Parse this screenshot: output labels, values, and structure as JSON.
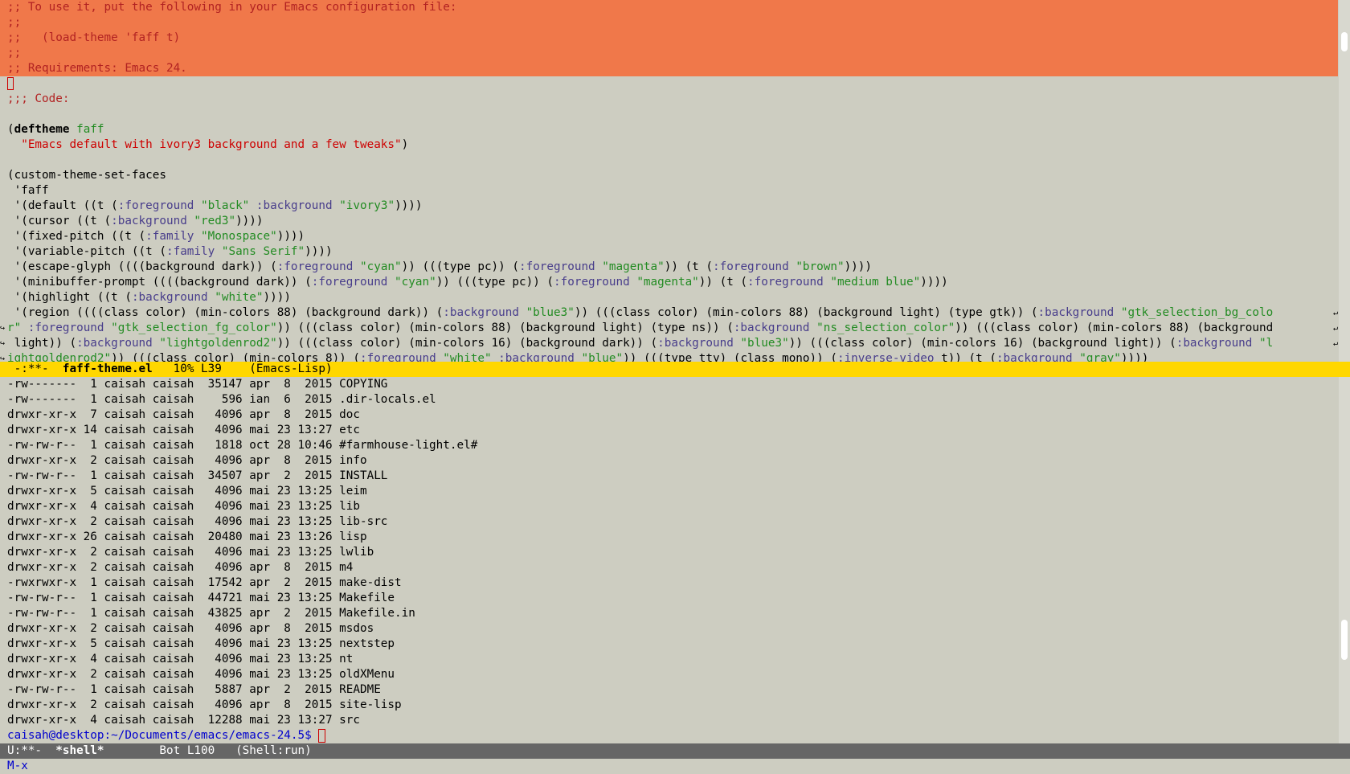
{
  "top_buffer": {
    "region_lines": [
      ";; To use it, put the following in your Emacs configuration file:",
      ";;",
      ";;   (load-theme 'faff t)",
      ";;",
      ";; Requirements: Emacs 24."
    ],
    "code_comment": ";;; Code:",
    "deftheme_kw": "deftheme",
    "deftheme_name": "faff",
    "deftheme_doc": "\"Emacs default with ivory3 background and a few tweaks\"",
    "custom_fn": "(custom-theme-set-faces",
    "quote_faff": " 'faff",
    "face_lines": [
      [
        {
          "t": " '(default ((t (",
          "c": ""
        },
        {
          "t": ":foreground",
          "c": "b"
        },
        {
          "t": " ",
          "c": ""
        },
        {
          "t": "\"black\"",
          "c": "s"
        },
        {
          "t": " ",
          "c": ""
        },
        {
          "t": ":background",
          "c": "b"
        },
        {
          "t": " ",
          "c": ""
        },
        {
          "t": "\"ivory3\"",
          "c": "s"
        },
        {
          "t": "))))",
          "c": ""
        }
      ],
      [
        {
          "t": " '(cursor ((t (",
          "c": ""
        },
        {
          "t": ":background",
          "c": "b"
        },
        {
          "t": " ",
          "c": ""
        },
        {
          "t": "\"red3\"",
          "c": "s"
        },
        {
          "t": "))))",
          "c": ""
        }
      ],
      [
        {
          "t": " '(fixed-pitch ((t (",
          "c": ""
        },
        {
          "t": ":family",
          "c": "b"
        },
        {
          "t": " ",
          "c": ""
        },
        {
          "t": "\"Monospace\"",
          "c": "s"
        },
        {
          "t": "))))",
          "c": ""
        }
      ],
      [
        {
          "t": " '(variable-pitch ((t (",
          "c": ""
        },
        {
          "t": ":family",
          "c": "b"
        },
        {
          "t": " ",
          "c": ""
        },
        {
          "t": "\"Sans Serif\"",
          "c": "s"
        },
        {
          "t": "))))",
          "c": ""
        }
      ],
      [
        {
          "t": " '(escape-glyph ((((background dark)) (",
          "c": ""
        },
        {
          "t": ":foreground",
          "c": "b"
        },
        {
          "t": " ",
          "c": ""
        },
        {
          "t": "\"cyan\"",
          "c": "s"
        },
        {
          "t": ")) (((type pc)) (",
          "c": ""
        },
        {
          "t": ":foreground",
          "c": "b"
        },
        {
          "t": " ",
          "c": ""
        },
        {
          "t": "\"magenta\"",
          "c": "s"
        },
        {
          "t": ")) (t (",
          "c": ""
        },
        {
          "t": ":foreground",
          "c": "b"
        },
        {
          "t": " ",
          "c": ""
        },
        {
          "t": "\"brown\"",
          "c": "s"
        },
        {
          "t": "))))",
          "c": ""
        }
      ],
      [
        {
          "t": " '(minibuffer-prompt ((((background dark)) (",
          "c": ""
        },
        {
          "t": ":foreground",
          "c": "b"
        },
        {
          "t": " ",
          "c": ""
        },
        {
          "t": "\"cyan\"",
          "c": "s"
        },
        {
          "t": ")) (((type pc)) (",
          "c": ""
        },
        {
          "t": ":foreground",
          "c": "b"
        },
        {
          "t": " ",
          "c": ""
        },
        {
          "t": "\"magenta\"",
          "c": "s"
        },
        {
          "t": ")) (t (",
          "c": ""
        },
        {
          "t": ":foreground",
          "c": "b"
        },
        {
          "t": " ",
          "c": ""
        },
        {
          "t": "\"medium blue\"",
          "c": "s"
        },
        {
          "t": "))))",
          "c": ""
        }
      ],
      [
        {
          "t": " '(highlight ((t (",
          "c": ""
        },
        {
          "t": ":background",
          "c": "b"
        },
        {
          "t": " ",
          "c": ""
        },
        {
          "t": "\"white\"",
          "c": "s"
        },
        {
          "t": "))))",
          "c": ""
        }
      ],
      [
        {
          "t": " '(region ((((class color) (min-colors 88) (background dark)) (",
          "c": ""
        },
        {
          "t": ":background",
          "c": "b"
        },
        {
          "t": " ",
          "c": ""
        },
        {
          "t": "\"blue3\"",
          "c": "s"
        },
        {
          "t": ")) (((class color) (min-colors 88) (background light) (type gtk)) (",
          "c": ""
        },
        {
          "t": ":background",
          "c": "b"
        },
        {
          "t": " ",
          "c": ""
        },
        {
          "t": "\"gtk_selection_bg_colo",
          "c": "s"
        }
      ],
      [
        {
          "t": "r\"",
          "c": "s"
        },
        {
          "t": " ",
          "c": ""
        },
        {
          "t": ":foreground",
          "c": "b"
        },
        {
          "t": " ",
          "c": ""
        },
        {
          "t": "\"gtk_selection_fg_color\"",
          "c": "s"
        },
        {
          "t": ")) (((class color) (min-colors 88) (background light) (type ns)) (",
          "c": ""
        },
        {
          "t": ":background",
          "c": "b"
        },
        {
          "t": " ",
          "c": ""
        },
        {
          "t": "\"ns_selection_color\"",
          "c": "s"
        },
        {
          "t": ")) (((class color) (min-colors 88) (background",
          "c": ""
        }
      ],
      [
        {
          "t": " light)) (",
          "c": ""
        },
        {
          "t": ":background",
          "c": "b"
        },
        {
          "t": " ",
          "c": ""
        },
        {
          "t": "\"lightgoldenrod2\"",
          "c": "s"
        },
        {
          "t": ")) (((class color) (min-colors 16) (background dark)) (",
          "c": ""
        },
        {
          "t": ":background",
          "c": "b"
        },
        {
          "t": " ",
          "c": ""
        },
        {
          "t": "\"blue3\"",
          "c": "s"
        },
        {
          "t": ")) (((class color) (min-colors 16) (background light)) (",
          "c": ""
        },
        {
          "t": ":background",
          "c": "b"
        },
        {
          "t": " ",
          "c": ""
        },
        {
          "t": "\"l",
          "c": "s"
        }
      ],
      [
        {
          "t": "ightgoldenrod2\"",
          "c": "s"
        },
        {
          "t": ")) (((class color) (min-colors 8)) (",
          "c": ""
        },
        {
          "t": ":foreground",
          "c": "b"
        },
        {
          "t": " ",
          "c": ""
        },
        {
          "t": "\"white\"",
          "c": "s"
        },
        {
          "t": " ",
          "c": ""
        },
        {
          "t": ":background",
          "c": "b"
        },
        {
          "t": " ",
          "c": ""
        },
        {
          "t": "\"blue\"",
          "c": "s"
        },
        {
          "t": ")) (((type tty) (class mono)) (",
          "c": ""
        },
        {
          "t": ":inverse-video",
          "c": "b"
        },
        {
          "t": " t)) (t (",
          "c": ""
        },
        {
          "t": ":background",
          "c": "b"
        },
        {
          "t": " ",
          "c": ""
        },
        {
          "t": "\"gray\"",
          "c": "s"
        },
        {
          "t": "))))",
          "c": ""
        }
      ]
    ]
  },
  "mode_line_top": {
    "status": " -:**-  ",
    "buffer": "faff-theme.el",
    "position": "   10% L39    ",
    "mode": "(Emacs-Lisp)"
  },
  "shell": {
    "listing": [
      "-rw-------  1 caisah caisah  35147 apr  8  2015 COPYING",
      "-rw-------  1 caisah caisah    596 ian  6  2015 .dir-locals.el",
      "drwxr-xr-x  7 caisah caisah   4096 apr  8  2015 doc",
      "drwxr-xr-x 14 caisah caisah   4096 mai 23 13:27 etc",
      "-rw-rw-r--  1 caisah caisah   1818 oct 28 10:46 #farmhouse-light.el#",
      "drwxr-xr-x  2 caisah caisah   4096 apr  8  2015 info",
      "-rw-rw-r--  1 caisah caisah  34507 apr  2  2015 INSTALL",
      "drwxr-xr-x  5 caisah caisah   4096 mai 23 13:25 leim",
      "drwxr-xr-x  4 caisah caisah   4096 mai 23 13:25 lib",
      "drwxr-xr-x  2 caisah caisah   4096 mai 23 13:25 lib-src",
      "drwxr-xr-x 26 caisah caisah  20480 mai 23 13:26 lisp",
      "drwxr-xr-x  2 caisah caisah   4096 mai 23 13:25 lwlib",
      "drwxr-xr-x  2 caisah caisah   4096 apr  8  2015 m4",
      "-rwxrwxr-x  1 caisah caisah  17542 apr  2  2015 make-dist",
      "-rw-rw-r--  1 caisah caisah  44721 mai 23 13:25 Makefile",
      "-rw-rw-r--  1 caisah caisah  43825 apr  2  2015 Makefile.in",
      "drwxr-xr-x  2 caisah caisah   4096 apr  8  2015 msdos",
      "drwxr-xr-x  5 caisah caisah   4096 mai 23 13:25 nextstep",
      "drwxr-xr-x  4 caisah caisah   4096 mai 23 13:25 nt",
      "drwxr-xr-x  2 caisah caisah   4096 mai 23 13:25 oldXMenu",
      "-rw-rw-r--  1 caisah caisah   5887 apr  2  2015 README",
      "drwxr-xr-x  2 caisah caisah   4096 apr  8  2015 site-lisp",
      "drwxr-xr-x  4 caisah caisah  12288 mai 23 13:27 src"
    ],
    "prompt": "caisah@desktop:~/Documents/emacs/emacs-24.5$ "
  },
  "mode_line_bottom": {
    "status": "U:**-  ",
    "buffer": "*shell*",
    "position": "        Bot L100   ",
    "mode": "(Shell:run)"
  },
  "minibuffer": {
    "text": "M-x"
  },
  "colors": {
    "region": "#f0784a",
    "background": "#cdcdc1",
    "active_modeline": "#ffd700",
    "inactive_modeline": "#666666",
    "comment": "#b22222",
    "string": "#8b2252",
    "builtin": "#483d8b",
    "prompt": "#0000cd"
  }
}
